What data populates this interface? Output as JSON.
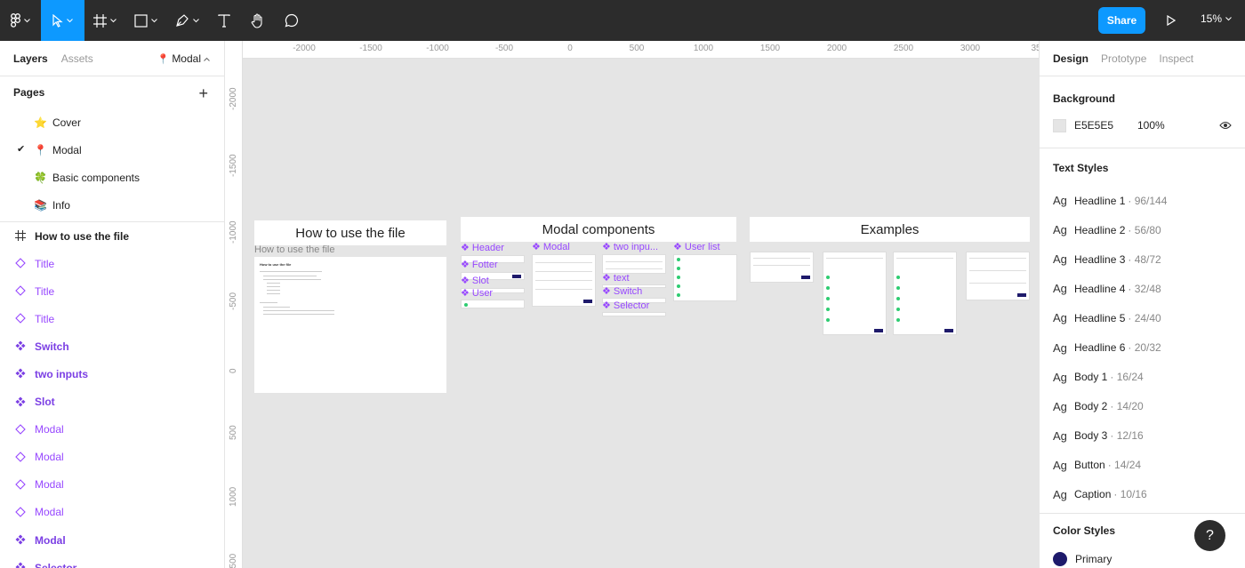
{
  "toolbar": {
    "share_label": "Share",
    "zoom_label": "15%"
  },
  "left_panel": {
    "tabs": {
      "layers": "Layers",
      "assets": "Assets"
    },
    "current_page": "Modal",
    "pages_title": "Pages",
    "pages": [
      {
        "emoji": "⭐",
        "label": "Cover"
      },
      {
        "emoji": "📍",
        "label": "Modal",
        "checked": "✔"
      },
      {
        "emoji": "🍀",
        "label": "Basic components"
      },
      {
        "emoji": "📚",
        "label": "Info"
      }
    ],
    "layers": [
      {
        "label": "How to use the file",
        "kind": "frame"
      },
      {
        "label": "Title",
        "kind": "inst"
      },
      {
        "label": "Title",
        "kind": "inst"
      },
      {
        "label": "Title",
        "kind": "inst"
      },
      {
        "label": "Switch",
        "kind": "comp"
      },
      {
        "label": "two inputs",
        "kind": "comp"
      },
      {
        "label": "Slot",
        "kind": "comp"
      },
      {
        "label": "Modal",
        "kind": "inst"
      },
      {
        "label": "Modal",
        "kind": "inst"
      },
      {
        "label": "Modal",
        "kind": "inst"
      },
      {
        "label": "Modal",
        "kind": "inst"
      },
      {
        "label": "Modal",
        "kind": "comp"
      },
      {
        "label": "Selector",
        "kind": "comp"
      }
    ]
  },
  "canvas": {
    "ruler_top": [
      "-2000",
      "-1500",
      "-1000",
      "-500",
      "0",
      "500",
      "1000",
      "1500",
      "2000",
      "2500",
      "3000",
      "35"
    ],
    "ruler_left": [
      "-2000",
      "-1500",
      "-1000",
      "-500",
      "0",
      "500",
      "1000",
      "1500"
    ],
    "frames": {
      "how_to": "How to use the file",
      "how_to_label": "How to use the file",
      "how_to_doc_title": "How to use the file",
      "modal_components": "Modal components",
      "examples": "Examples"
    },
    "component_labels": {
      "header": "Header",
      "footer": "Fotter",
      "slot": "Slot",
      "user": "User",
      "modal": "Modal",
      "two_inputs": "two inpu...",
      "text": "text",
      "switch": "Switch",
      "selector": "Selector",
      "user_list": "User list"
    }
  },
  "right_panel": {
    "tabs": {
      "design": "Design",
      "prototype": "Prototype",
      "inspect": "Inspect"
    },
    "background_title": "Background",
    "background_hex": "E5E5E5",
    "background_opacity": "100%",
    "text_styles_title": "Text Styles",
    "text_styles": [
      {
        "name": "Headline 1",
        "spec": "· 96/144"
      },
      {
        "name": "Headline 2",
        "spec": "· 56/80"
      },
      {
        "name": "Headline 3",
        "spec": "· 48/72"
      },
      {
        "name": "Headline 4",
        "spec": "· 32/48"
      },
      {
        "name": "Headline 5",
        "spec": "· 24/40"
      },
      {
        "name": "Headline 6",
        "spec": "· 20/32"
      },
      {
        "name": "Body 1",
        "spec": "· 16/24"
      },
      {
        "name": "Body 2",
        "spec": "· 14/20"
      },
      {
        "name": "Body 3",
        "spec": "· 12/16"
      },
      {
        "name": "Button",
        "spec": "· 14/24"
      },
      {
        "name": "Caption",
        "spec": "· 10/16"
      }
    ],
    "ag_label": "Ag",
    "color_styles_title": "Color Styles",
    "color_styles": [
      {
        "name": "Primary",
        "hex": "#1e1a6b"
      }
    ],
    "help_label": "?"
  },
  "colors": {
    "accent": "#0d99ff",
    "toolbar_bg": "#2c2c2c",
    "component": "#9747ff",
    "primary": "#1e1a6b"
  }
}
